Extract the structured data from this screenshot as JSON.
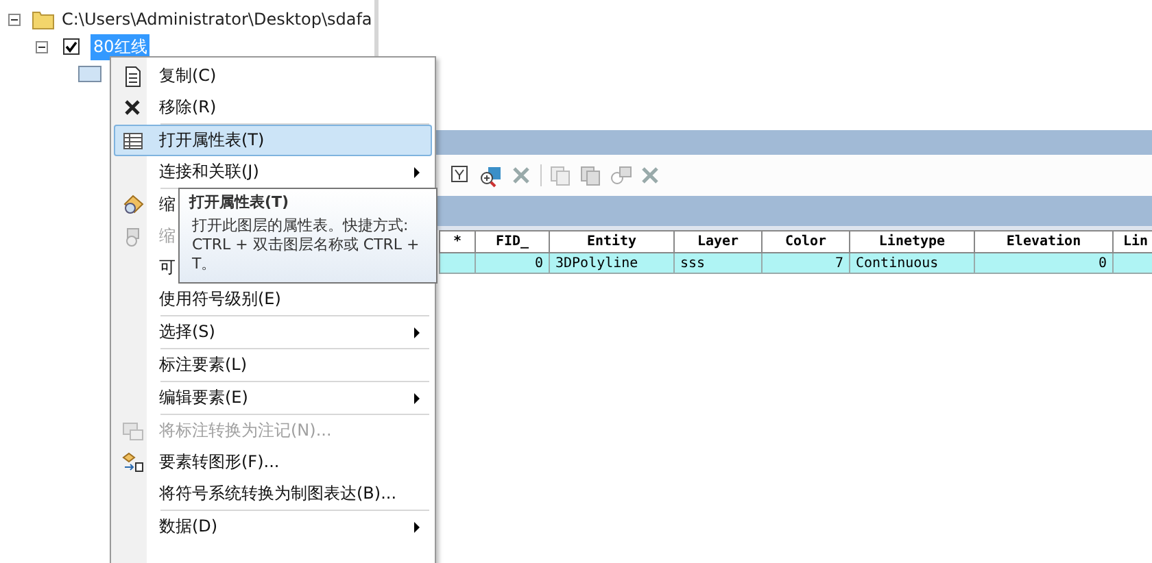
{
  "toc": {
    "folder": "C:\\Users\\Administrator\\Desktop\\sdafa",
    "layer": {
      "name": "80红线",
      "checked": true,
      "expanded": true,
      "selected": true
    }
  },
  "table_window": {
    "columns": [
      "*",
      "FID_",
      "Entity",
      "Layer",
      "Color",
      "Linetype",
      "Elevation",
      "Lin"
    ],
    "rows": [
      {
        "selected": true,
        "cells": [
          "",
          "0",
          "3DPolyline",
          "sss",
          "7",
          "Continuous",
          "0",
          ""
        ]
      }
    ]
  },
  "context_menu": [
    {
      "kind": "item",
      "label": "复制(C)",
      "submenu": false,
      "disabled": false,
      "selected": false
    },
    {
      "kind": "item",
      "label": "移除(R)",
      "submenu": false,
      "disabled": false,
      "selected": false
    },
    {
      "kind": "separator"
    },
    {
      "kind": "item",
      "label": "打开属性表(T)",
      "submenu": false,
      "disabled": false,
      "selected": true
    },
    {
      "kind": "item",
      "label": "连接和关联(J)",
      "submenu": true,
      "disabled": false,
      "selected": false
    },
    {
      "kind": "separator"
    },
    {
      "kind": "item",
      "label": "缩",
      "submenu": false,
      "disabled": false,
      "selected": false
    },
    {
      "kind": "item",
      "label": "缩",
      "submenu": false,
      "disabled": true,
      "selected": false
    },
    {
      "kind": "item",
      "label": "可",
      "submenu": false,
      "disabled": false,
      "selected": false
    },
    {
      "kind": "item",
      "label": "使用符号级别(E)",
      "submenu": false,
      "disabled": false,
      "selected": false
    },
    {
      "kind": "separator"
    },
    {
      "kind": "item",
      "label": "选择(S)",
      "submenu": true,
      "disabled": false,
      "selected": false
    },
    {
      "kind": "separator"
    },
    {
      "kind": "item",
      "label": "标注要素(L)",
      "submenu": false,
      "disabled": false,
      "selected": false
    },
    {
      "kind": "separator"
    },
    {
      "kind": "item",
      "label": "编辑要素(E)",
      "submenu": true,
      "disabled": false,
      "selected": false
    },
    {
      "kind": "separator"
    },
    {
      "kind": "item",
      "label": "将标注转换为注记(N)...",
      "submenu": false,
      "disabled": true,
      "selected": false
    },
    {
      "kind": "item",
      "label": "要素转图形(F)...",
      "submenu": false,
      "disabled": false,
      "selected": false
    },
    {
      "kind": "item",
      "label": "将符号系统转换为制图表达(B)...",
      "submenu": false,
      "disabled": false,
      "selected": false
    },
    {
      "kind": "separator"
    },
    {
      "kind": "item",
      "label": "数据(D)",
      "submenu": true,
      "disabled": false,
      "selected": false
    }
  ],
  "tooltip": {
    "title": "打开属性表(T)",
    "text": "打开此图层的属性表。快捷方式: CTRL + 双击图层名称或 CTRL + T。"
  }
}
